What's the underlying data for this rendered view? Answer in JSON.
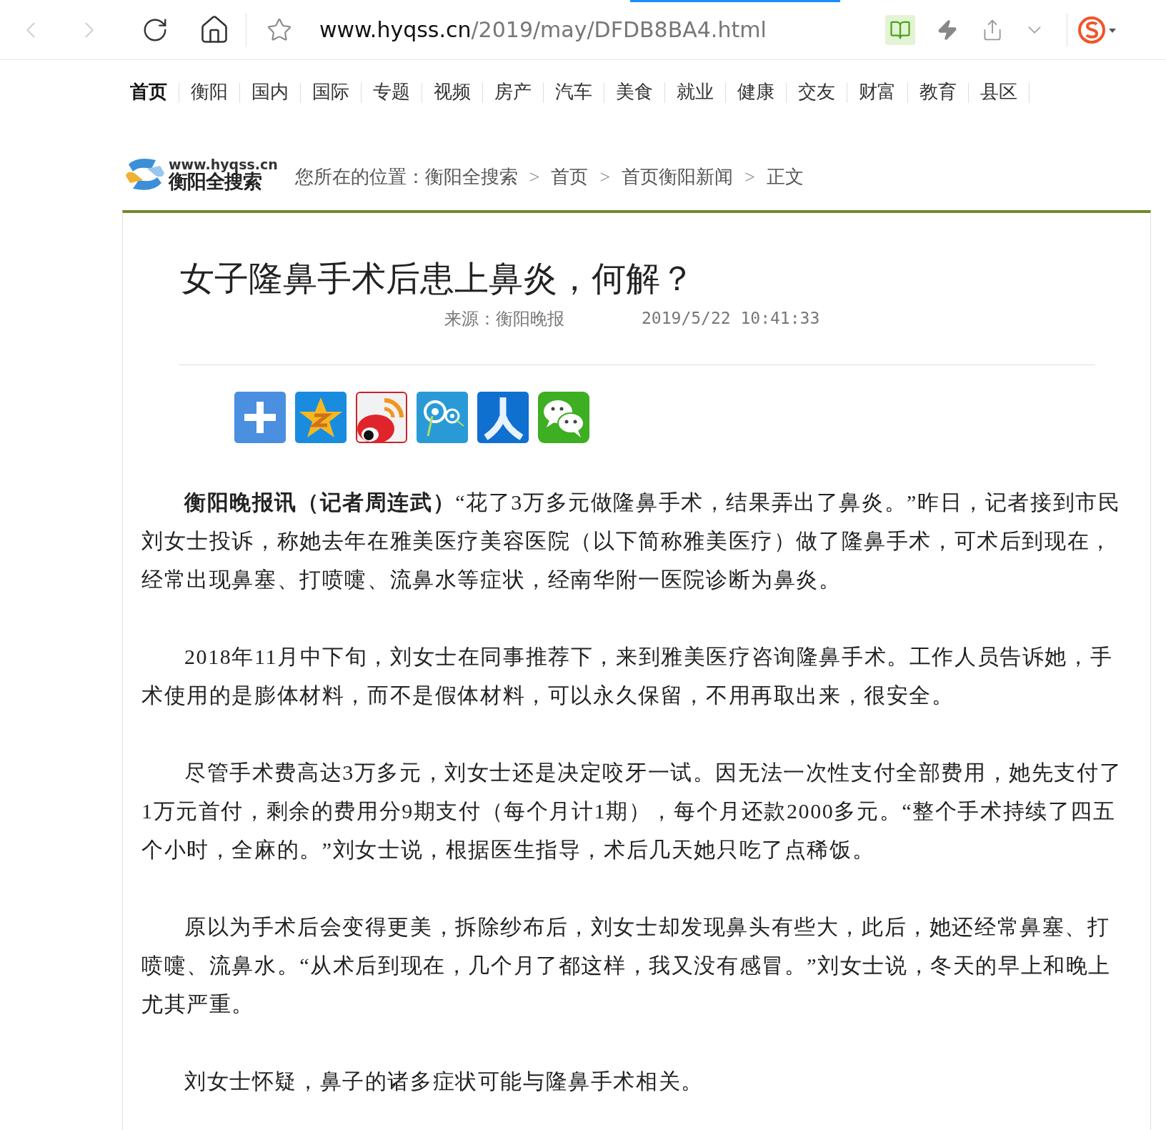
{
  "browser": {
    "url_host": "www.hyqss.cn",
    "url_path": "/2019/may/DFDB8BA4.html",
    "back_disabled": true,
    "forward_disabled": true
  },
  "nav": [
    {
      "label": "首页",
      "selected": true
    },
    {
      "label": "衡阳",
      "selected": false
    },
    {
      "label": "国内",
      "selected": false
    },
    {
      "label": "国际",
      "selected": false
    },
    {
      "label": "专题",
      "selected": false
    },
    {
      "label": "视频",
      "selected": false
    },
    {
      "label": "房产",
      "selected": false
    },
    {
      "label": "汽车",
      "selected": false
    },
    {
      "label": "美食",
      "selected": false
    },
    {
      "label": "就业",
      "selected": false
    },
    {
      "label": "健康",
      "selected": false
    },
    {
      "label": "交友",
      "selected": false
    },
    {
      "label": "财富",
      "selected": false
    },
    {
      "label": "教育",
      "selected": false
    },
    {
      "label": "县区",
      "selected": false
    }
  ],
  "logo": {
    "domain": "www.hyqss.cn",
    "name": "衡阳全搜索"
  },
  "breadcrumb": {
    "label": "您所在的位置：",
    "items": [
      "衡阳全搜索",
      "首页",
      "首页衡阳新闻",
      "正文"
    ],
    "separator": ">"
  },
  "article": {
    "title": "女子隆鼻手术后患上鼻炎，何解？",
    "source": "来源：衡阳晚报",
    "date": "2019/5/22 10:41:33",
    "share": [
      {
        "kind": "more"
      },
      {
        "kind": "qzone"
      },
      {
        "kind": "weibo"
      },
      {
        "kind": "tqq"
      },
      {
        "kind": "renren"
      },
      {
        "kind": "wechat"
      }
    ],
    "paragraphs": [
      "**衡阳晚报讯（记者周连武）**“花了3万多元做隆鼻手术，结果弄出了鼻炎。”昨日，记者接到市民刘女士投诉，称她去年在雅美医疗美容医院（以下简称雅美医疗）做了隆鼻手术，可术后到现在，经常出现鼻塞、打喷嚏、流鼻水等症状，经南华附一医院诊断为鼻炎。",
      "2018年11月中下旬，刘女士在同事推荐下，来到雅美医疗咨询隆鼻手术。工作人员告诉她，手术使用的是膨体材料，而不是假体材料，可以永久保留，不用再取出来，很安全。",
      "尽管手术费高达3万多元，刘女士还是决定咬牙一试。因无法一次性支付全部费用，她先支付了1万元首付，剩余的费用分9期支付（每个月计1期），每个月还款2000多元。“整个手术持续了四五个小时，全麻的。”刘女士说，根据医生指导，术后几天她只吃了点稀饭。",
      "原以为手术后会变得更美，拆除纱布后，刘女士却发现鼻头有些大，此后，她还经常鼻塞、打喷嚏、流鼻水。“从术后到现在，几个月了都这样，我又没有感冒。”刘女士说，冬天的早上和晚上尤其严重。",
      "刘女士怀疑，鼻子的诸多症状可能与隆鼻手术相关。"
    ]
  }
}
